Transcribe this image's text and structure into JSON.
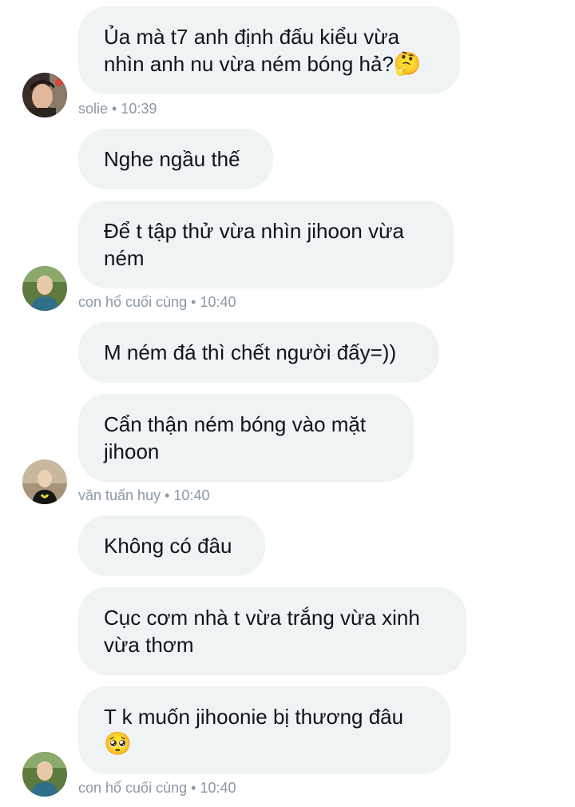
{
  "messages": [
    {
      "text": "Ủa mà t7 anh định đấu kiểu vừa nhìn anh nu vừa ném bóng hả?",
      "emoji": "🤔"
    },
    {
      "text": "Nghe ngầu thế"
    },
    {
      "text": "Để t tập thử vừa nhìn jihoon vừa ném"
    },
    {
      "text": "M ném đá thì chết người đấy=))"
    },
    {
      "text": "Cẩn thận ném bóng vào mặt jihoon"
    },
    {
      "text": "Không có đâu"
    },
    {
      "text": "Cục cơm nhà t vừa trắng vừa xinh vừa thơm"
    },
    {
      "text": "T k muốn jihoonie bị thương đâu",
      "emoji": "🥺"
    }
  ],
  "meta": [
    {
      "sender": "solie",
      "time": "10:39"
    },
    {
      "sender": "con hổ cuối cùng",
      "time": "10:40"
    },
    {
      "sender": "văn tuấn huy",
      "time": "10:40"
    },
    {
      "sender": "con hổ cuối cùng",
      "time": "10:40"
    }
  ],
  "separator": "•",
  "colors": {
    "bubble_bg": "#eff3f4",
    "text": "#0f1419",
    "meta": "#8b98a5"
  }
}
